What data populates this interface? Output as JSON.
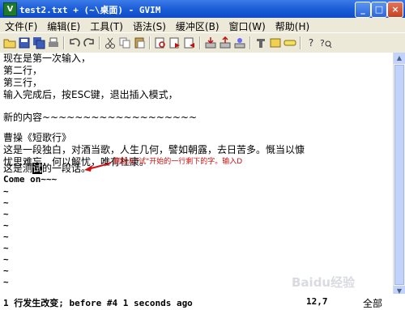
{
  "window": {
    "title": "test2.txt + (~\\桌面) - GVIM",
    "icon_label": "V",
    "minimize": "_",
    "maximize": "□",
    "close": "×"
  },
  "menu": [
    "文件(F)",
    "编辑(E)",
    "工具(T)",
    "语法(S)",
    "缓冲区(B)",
    "窗口(W)",
    "帮助(H)"
  ],
  "toolbar_icons": [
    "open-icon",
    "save-icon",
    "save-all-icon",
    "print-icon",
    "undo-icon",
    "redo-icon",
    "cut-icon",
    "copy-icon",
    "paste-icon",
    "find-replace-icon",
    "find-next-icon",
    "find-prev-icon",
    "load-session-icon",
    "save-session-icon",
    "run-script-icon",
    "make-icon",
    "shell-icon",
    "tags-icon",
    "jump-tag-icon",
    "help-icon",
    "find-help-icon"
  ],
  "editor": {
    "lines": [
      "现在是第一次输入，",
      "第二行，",
      "第三行，",
      "输入完成后，按ESC键，退出插入模式，",
      "",
      "新的内容~~~~~~~~~~~~~~~~~~~",
      "",
      "曹操《短歌行》",
      "这是一段独白，对酒当歌，人生几何，譬如朝露，去日苦多。慨当以慷",
      "忧思难忘，何以解忧，唯有杜康。",
      ""
    ],
    "cursor_line": {
      "before": "这是测",
      "cursor": "试",
      "after": "的一段话。"
    },
    "code_line": "Come on~~~",
    "tilde": "~"
  },
  "annotation": "删除从\"试\"开始的一行剩下的字。输入D",
  "status": {
    "message": "1 行发生改变; before #4  1 seconds ago",
    "position": "12,7",
    "percent": "全部"
  },
  "watermark": "Baidu经验",
  "colors": {
    "titlebar": "#1a5bd6",
    "annotation": "#d01010",
    "chrome": "#ece9d8"
  }
}
